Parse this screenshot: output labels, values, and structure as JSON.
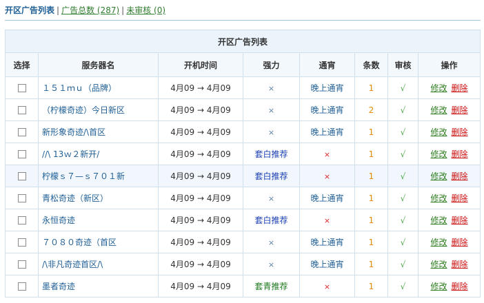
{
  "nav": {
    "title": "开区广告列表",
    "sep": "|",
    "total_label": "广告总数 (287)",
    "pending_label": "未审核 (0)"
  },
  "table": {
    "caption": "开区广告列表",
    "headers": [
      "选择",
      "服务器名",
      "开机时间",
      "强力",
      "通宵",
      "条数",
      "审核",
      "操作"
    ],
    "edit_label": "修改",
    "delete_label": "删除",
    "rows": [
      {
        "name": "１５１ｍｕ（品牌）",
        "time": "4月09 → 4月09",
        "power": "×",
        "overnight": "晚上通宵",
        "count": "1",
        "approved": "√"
      },
      {
        "name": "（柠檬奇迹）今日新区",
        "time": "4月09 → 4月09",
        "power": "×",
        "overnight": "晚上通宵",
        "count": "2",
        "approved": "√"
      },
      {
        "name": "新形象奇迹/\\首区",
        "time": "4月09 → 4月09",
        "power": "×",
        "overnight": "晚上通宵",
        "count": "1",
        "approved": "√"
      },
      {
        "name": "//\\ 13ｗ２新开/",
        "time": "4月09 → 4月09",
        "power": "套白推荐",
        "overnight": "×",
        "count": "1",
        "approved": "√"
      },
      {
        "name": "柠檬ｓ７—ｓ７０１新",
        "time": "4月09 → 4月09",
        "power": "套白推荐",
        "overnight": "×",
        "count": "1",
        "approved": "√"
      },
      {
        "name": "青松奇迹（新区）",
        "time": "4月09 → 4月09",
        "power": "×",
        "overnight": "晚上通宵",
        "count": "1",
        "approved": "√"
      },
      {
        "name": "永恒奇迹",
        "time": "4月09 → 4月09",
        "power": "套白推荐",
        "overnight": "×",
        "count": "1",
        "approved": "√"
      },
      {
        "name": "７０８０奇迹（首区",
        "time": "4月09 → 4月09",
        "power": "×",
        "overnight": "晚上通宵",
        "count": "1",
        "approved": "√"
      },
      {
        "name": "/\\非凡奇迹首区/\\",
        "time": "4月09 → 4月09",
        "power": "×",
        "overnight": "晚上通宵",
        "count": "1",
        "approved": "√"
      },
      {
        "name": "墨者奇迹",
        "time": "4月09 → 4月09",
        "power": "套青推荐",
        "overnight": "×",
        "count": "1",
        "approved": "√"
      }
    ]
  },
  "colors": {
    "link_blue": "#1f5f96",
    "link_green": "#2f7d2f",
    "delete_red": "#cc1111",
    "count_orange": "#e08a00",
    "approved_green": "#4aa74a",
    "border": "#cfe0ec",
    "header_bg": "#ebf4fb"
  }
}
